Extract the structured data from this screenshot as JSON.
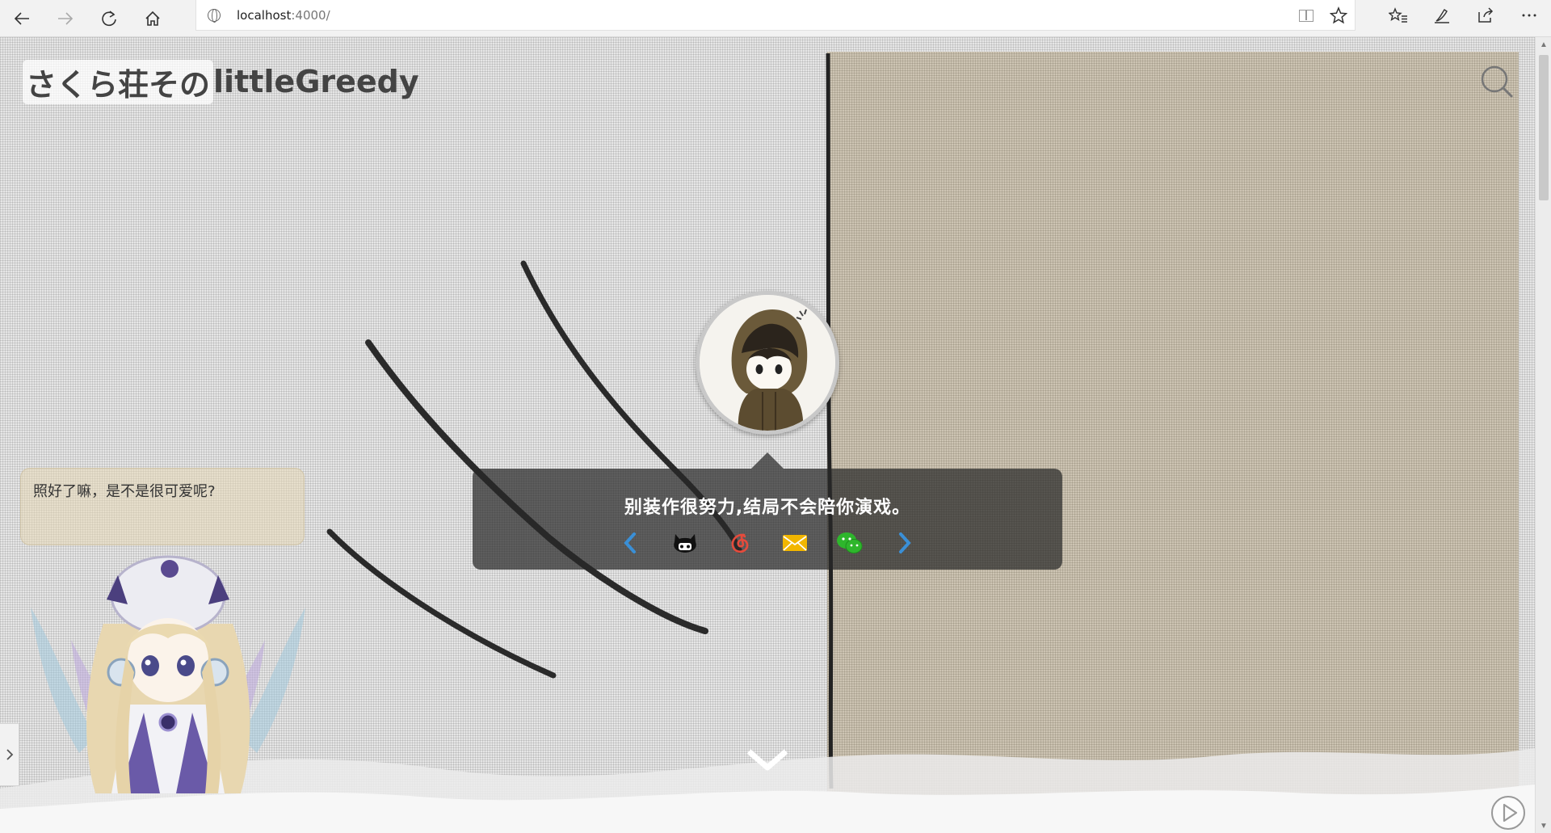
{
  "browser": {
    "url_host": "localhost",
    "url_rest": ":4000/"
  },
  "site": {
    "title_highlight": "さくら荘その",
    "title_rest": "littleGreedy"
  },
  "hero": {
    "motto": "别装作很努力,结局不会陪你演戏。"
  },
  "mascot": {
    "speech": "照好了嘛，是不是很可爱呢?"
  },
  "social": {
    "prev": "chevron-left-icon",
    "items": [
      "github-icon",
      "netease-music-icon",
      "email-icon",
      "wechat-icon"
    ],
    "next": "chevron-right-icon"
  },
  "colors": {
    "accent_blue": "#3a8fd6",
    "netease_red": "#e54b3c",
    "email_yellow": "#f2b600",
    "wechat_green": "#2eb62c"
  }
}
